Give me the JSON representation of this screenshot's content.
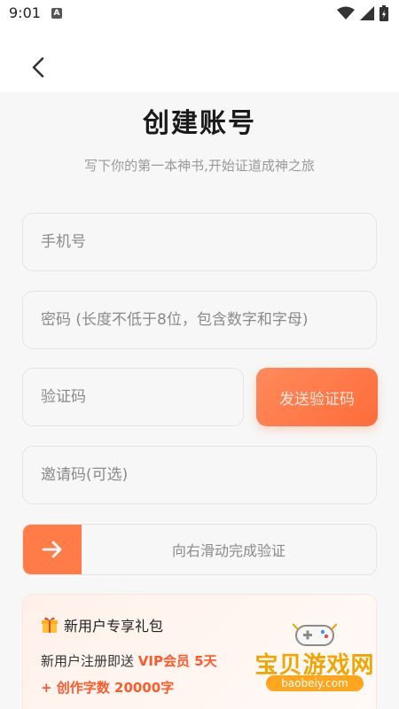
{
  "status_bar": {
    "time": "9:01",
    "notification_icon": "A"
  },
  "header": {
    "back_icon": "chevron-left-icon"
  },
  "title": "创建账号",
  "subtitle": "写下你的第一本神书,开始证道成神之旅",
  "form": {
    "phone_placeholder": "手机号",
    "password_placeholder": "密码 (长度不低于8位，包含数字和字母)",
    "code_placeholder": "验证码",
    "send_code_label": "发送验证码",
    "invite_placeholder": "邀请码(可选)"
  },
  "slider": {
    "text": "向右滑动完成验证",
    "handle_icon": "arrow-right-icon"
  },
  "gift": {
    "icon": "gift-icon",
    "title": "新用户专享礼包",
    "line1_prefix": "新用户注册即送 ",
    "line1_highlight": "VIP会员 5天",
    "line2": "+ 创作字数 20000字"
  },
  "watermark": {
    "text": "宝贝游戏网",
    "url": "baobeiy.com"
  },
  "colors": {
    "accent": "#ff7b47",
    "accent_dark": "#ff5a2a",
    "background": "#f7f7f7"
  }
}
